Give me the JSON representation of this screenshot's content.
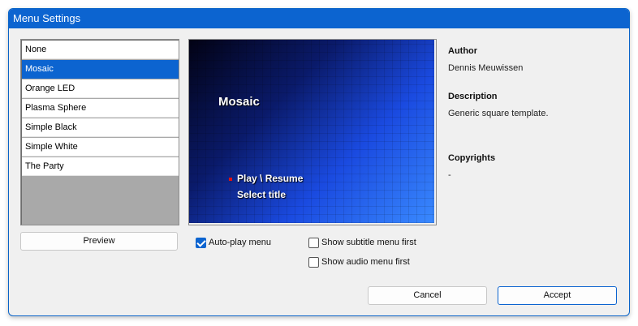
{
  "window": {
    "title": "Menu Settings"
  },
  "templates": {
    "items": [
      "None",
      "Mosaic",
      "Orange LED",
      "Plasma Sphere",
      "Simple Black",
      "Simple White",
      "The Party"
    ],
    "selected": "Mosaic"
  },
  "preview_button": "Preview",
  "preview": {
    "title": "Mosaic",
    "menu_items": [
      "Play \\ Resume",
      "Select title"
    ]
  },
  "info": {
    "author_label": "Author",
    "author": "Dennis Meuwissen",
    "description_label": "Description",
    "description": "Generic square template.",
    "copyrights_label": "Copyrights",
    "copyrights": "-"
  },
  "options": {
    "autoplay": {
      "label": "Auto-play menu",
      "checked": true
    },
    "subtitle_first": {
      "label": "Show subtitle menu first",
      "checked": false
    },
    "audio_first": {
      "label": "Show audio menu first",
      "checked": false
    }
  },
  "buttons": {
    "cancel": "Cancel",
    "accept": "Accept"
  },
  "colors": {
    "accent": "#0c64d0",
    "selection": "#0c64d0"
  }
}
